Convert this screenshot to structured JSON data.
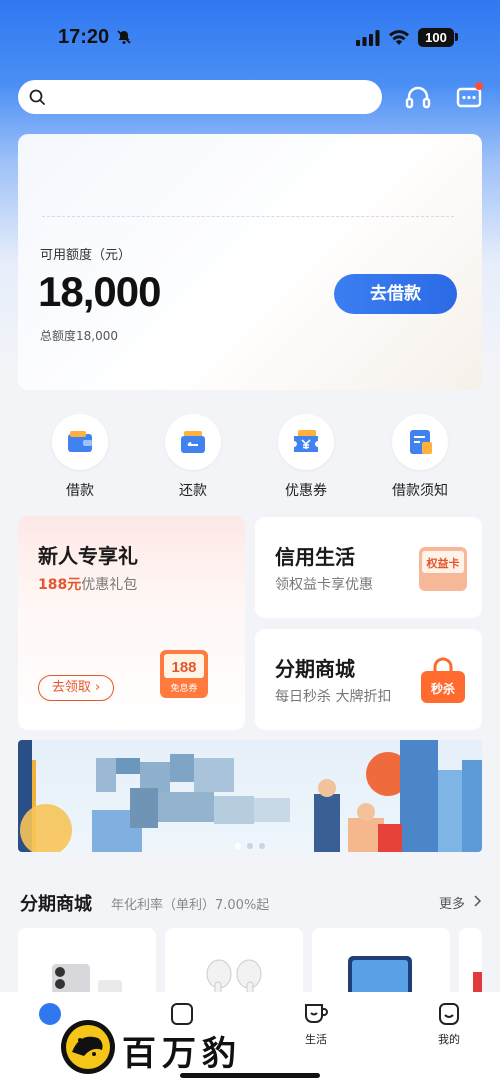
{
  "status_bar": {
    "time": "17:20",
    "battery": "100"
  },
  "search": {
    "placeholder": ""
  },
  "credit": {
    "label": "可用额度（元）",
    "amount": "18,000",
    "total": "总额度18,000",
    "borrow_button": "去借款"
  },
  "quick_actions": [
    {
      "label": "借款",
      "icon": "wallet-icon"
    },
    {
      "label": "还款",
      "icon": "card-icon"
    },
    {
      "label": "优惠券",
      "icon": "coupon-ticket-icon"
    },
    {
      "label": "借款须知",
      "icon": "document-icon"
    }
  ],
  "gift_card": {
    "title": "新人专享礼",
    "highlight": "188元",
    "subtitle": "优惠礼包",
    "claim_button": "去领取",
    "coupon_amount": "188",
    "coupon_label": "免息券"
  },
  "credit_life": {
    "title": "信用生活",
    "subtitle": "领权益卡享优惠",
    "badge": "权益卡"
  },
  "installment_mall": {
    "title": "分期商城",
    "subtitle": "每日秒杀 大牌折扣",
    "badge": "秒杀"
  },
  "mall_section": {
    "title": "分期商城",
    "subtitle": "年化利率（单利）7.00%起",
    "more": "更多"
  },
  "tab_bar": {
    "life": "生活",
    "mine": "我的"
  },
  "watermark": {
    "text": "百万豹"
  },
  "colors": {
    "brand_blue": "#2f78f0",
    "accent_orange": "#e4572e"
  }
}
